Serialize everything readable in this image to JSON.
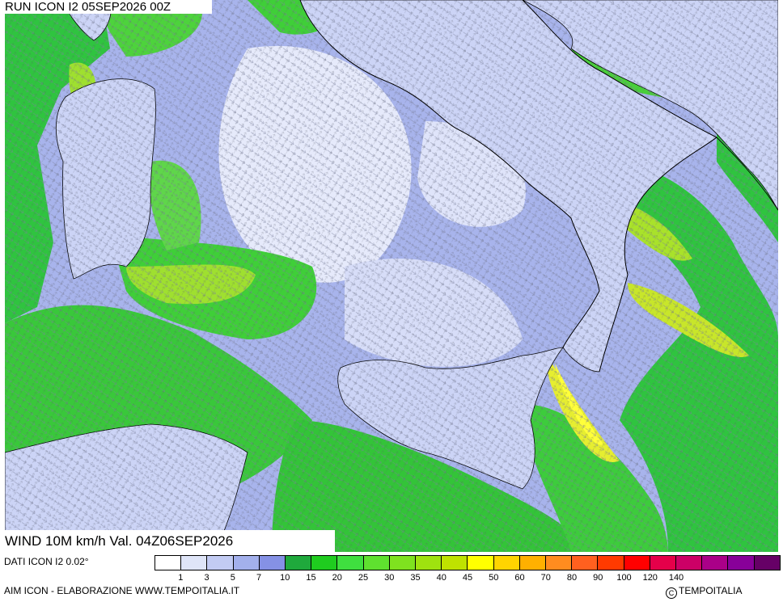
{
  "header": {
    "run_label": "RUN ICON I2 05SEP2026 00Z"
  },
  "footer": {
    "field_label": "WIND 10M km/h Val. 04Z06SEP2026",
    "data_source": "DATI ICON I2 0.02°",
    "credits": "AIM ICON - ELABORAZIONE WWW.TEMPOITALIA.IT",
    "copyright": "TEMPOITALIA",
    "copyright_symbol": "C"
  },
  "legend": {
    "colors": [
      "#ffffff",
      "#dfe5f8",
      "#c2cbf3",
      "#a3b0ec",
      "#8591e5",
      "#1fa93c",
      "#1fcc1f",
      "#3fdf3f",
      "#5fe12f",
      "#7fe21f",
      "#9fe20f",
      "#bfe200",
      "#ffff00",
      "#ffd400",
      "#ffb000",
      "#ff8c1f",
      "#ff601f",
      "#ff3a00",
      "#ff0000",
      "#e5004a",
      "#cc0066",
      "#aa0088",
      "#880099",
      "#660066"
    ],
    "ticks": [
      "1",
      "3",
      "5",
      "7",
      "10",
      "15",
      "20",
      "25",
      "30",
      "35",
      "40",
      "45",
      "50",
      "60",
      "70",
      "80",
      "90",
      "100",
      "120",
      "140"
    ]
  },
  "map": {
    "sea_color": "#a8b4ec",
    "land_color": "#ccd4f6",
    "calm_color": "#eef1fc",
    "moderate_wind_color": "#2fc43f",
    "strong_wind_color": "#b8e62a",
    "gale_color": "#ffff3a"
  }
}
